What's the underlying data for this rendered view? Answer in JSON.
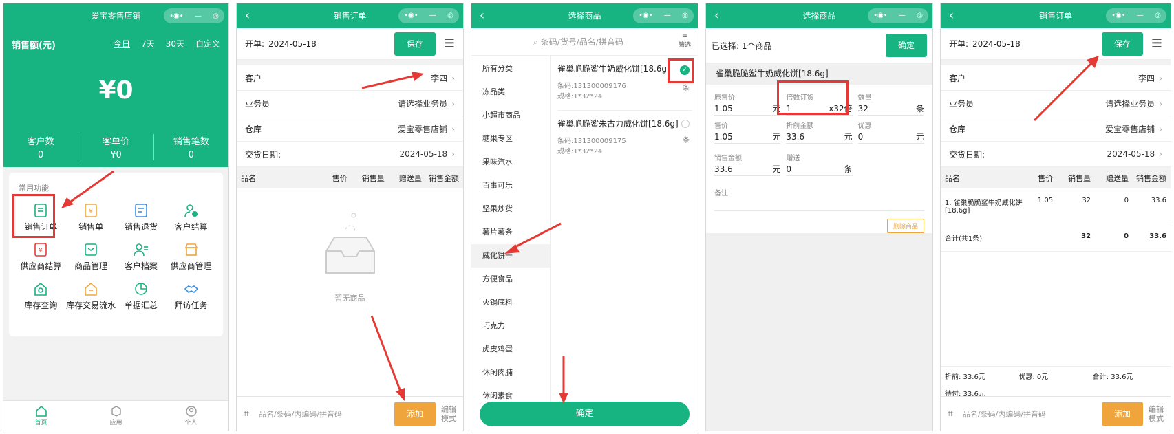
{
  "p1": {
    "title": "爱宝零售店铺",
    "sales_label": "销售额(元)",
    "tabs": [
      "今日",
      "7天",
      "30天",
      "自定义"
    ],
    "amount": "¥0",
    "stats": [
      {
        "label": "客户数",
        "value": "0"
      },
      {
        "label": "客单价",
        "value": "¥0"
      },
      {
        "label": "销售笔数",
        "value": "0"
      }
    ],
    "section": "常用功能",
    "items": [
      "销售订单",
      "销售单",
      "销售退货",
      "客户结算",
      "供应商结算",
      "商品管理",
      "客户档案",
      "供应商管理",
      "库存查询",
      "库存交易流水",
      "单据汇总",
      "拜访任务"
    ],
    "nav": [
      "首页",
      "应用",
      "个人"
    ]
  },
  "p2": {
    "title": "销售订单",
    "open_label": "开单:",
    "date": "2024-05-18",
    "save": "保存",
    "rows": [
      {
        "label": "客户",
        "value": "李四"
      },
      {
        "label": "业务员",
        "value": "请选择业务员"
      },
      {
        "label": "仓库",
        "value": "爱宝零售店铺"
      },
      {
        "label": "交货日期:",
        "value": "2024-05-18"
      }
    ],
    "headers": [
      "品名",
      "售价",
      "销售量",
      "赠送量",
      "销售金额"
    ],
    "empty": "暂无商品",
    "search_ph": "品名/条码/内编码/拼音码",
    "add": "添加",
    "edit": "编辑\n模式"
  },
  "p3": {
    "title": "选择商品",
    "search_ph": "条码/货号/品名/拼音码",
    "filter": "筛选",
    "categories": [
      "所有分类",
      "冻品类",
      "小超市商品",
      "糖果专区",
      "果味汽水",
      "百事可乐",
      "坚果炒货",
      "薯片薯条",
      "威化饼干",
      "方便食品",
      "火锅底料",
      "巧克力",
      "虎皮鸡蛋",
      "休闲肉脯",
      "休闲素食"
    ],
    "products": [
      {
        "name": "雀巢脆脆鲨牛奶威化饼[18.6g]",
        "barcode": "条码:131300009176",
        "spec": "规格:1*32*24",
        "unit": "条"
      },
      {
        "name": "雀巢脆脆鲨朱古力威化饼[18.6g]",
        "barcode": "条码:131300009175",
        "spec": "规格:1*32*24",
        "unit": "条"
      }
    ],
    "confirm": "确定"
  },
  "p4": {
    "title": "选择商品",
    "selected": "已选择:  1个商品",
    "confirm": "确定",
    "product": "雀巢脆脆鲨牛奶威化饼[18.6g]",
    "f_orig": "原售价",
    "v_orig": "1.05",
    "f_mult": "倍数订货",
    "v_mult": "1",
    "v_mult_suffix": "x32倍",
    "f_qty": "数量",
    "v_qty": "32",
    "u_qty": "条",
    "f_price": "售价",
    "v_price": "1.05",
    "f_disc": "折前金额",
    "v_disc": "33.6",
    "f_off": "优惠",
    "v_off": "0",
    "f_amt": "销售金额",
    "v_amt": "33.6",
    "f_gift": "赠送",
    "v_gift": "0",
    "u_gift": "条",
    "unit_yuan": "元",
    "note": "备注",
    "delete": "删除商品"
  },
  "p5": {
    "title": "销售订单",
    "open_label": "开单:",
    "date": "2024-05-18",
    "save": "保存",
    "rows": [
      {
        "label": "客户",
        "value": "李四"
      },
      {
        "label": "业务员",
        "value": "请选择业务员"
      },
      {
        "label": "仓库",
        "value": "爱宝零售店铺"
      },
      {
        "label": "交货日期:",
        "value": "2024-05-18"
      }
    ],
    "headers": [
      "品名",
      "售价",
      "销售量",
      "赠送量",
      "销售金额"
    ],
    "line": {
      "name": "1. 雀巢脆脆鲨牛奶威化饼[18.6g]",
      "price": "1.05",
      "qty": "32",
      "gift": "0",
      "amount": "33.6"
    },
    "total": {
      "label": "合计(共1条)",
      "qty": "32",
      "gift": "0",
      "amount": "33.6"
    },
    "before": "折前:  33.6元",
    "discount": "优惠:  0元",
    "sum": "合计:  33.6元",
    "pay": "待付:  33.6元",
    "search_ph": "品名/条码/内编码/拼音码",
    "add": "添加",
    "edit": "编辑\n模式"
  }
}
